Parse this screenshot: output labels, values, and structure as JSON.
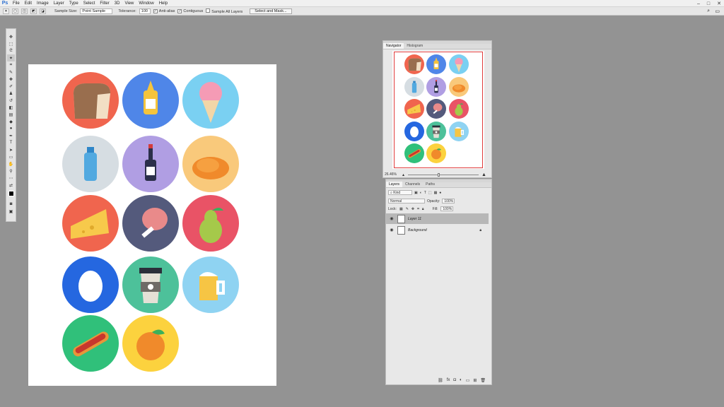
{
  "app": {
    "logo": "Ps"
  },
  "menu": [
    "File",
    "Edit",
    "Image",
    "Layer",
    "Type",
    "Select",
    "Filter",
    "3D",
    "View",
    "Window",
    "Help"
  ],
  "window_controls": [
    "–",
    "□",
    "✕"
  ],
  "options": {
    "sample_size_label": "Sample Size:",
    "sample_size_value": "Point Sample",
    "tolerance_label": "Tolerance:",
    "tolerance_value": "100",
    "anti_alias_label": "Anti-alias",
    "contiguous_label": "Contiguous",
    "sample_all_label": "Sample All Layers",
    "select_mask_label": "Select and Mask..."
  },
  "icons": [
    {
      "name": "bread-icon",
      "color": "#f0654e"
    },
    {
      "name": "mustard-icon",
      "color": "#4f86e8"
    },
    {
      "name": "icecream-icon",
      "color": "#7ad0f2"
    },
    {
      "name": "water-bottle-icon",
      "color": "#d6dde2"
    },
    {
      "name": "wine-icon",
      "color": "#b09ee3"
    },
    {
      "name": "roast-chicken-icon",
      "color": "#f9c97b"
    },
    {
      "name": "cheese-icon",
      "color": "#f0654e"
    },
    {
      "name": "ham-icon",
      "color": "#545a7c"
    },
    {
      "name": "pear-icon",
      "color": "#e95366"
    },
    {
      "name": "egg-icon",
      "color": "#2567e0"
    },
    {
      "name": "coffee-cup-icon",
      "color": "#4dc19a"
    },
    {
      "name": "beer-icon",
      "color": "#8fd3f2"
    },
    {
      "name": "hotdog-icon",
      "color": "#30c07a"
    },
    {
      "name": "orange-icon",
      "color": "#fcd23e"
    }
  ],
  "navigator": {
    "tabs": [
      "Navigator",
      "Histogram"
    ],
    "zoom": "26.46%"
  },
  "layers": {
    "tabs": [
      "Layers",
      "Channels",
      "Paths"
    ],
    "kind_label": "Kind",
    "blend_mode": "Normal",
    "opacity_label": "Opacity:",
    "opacity_value": "100%",
    "lock_label": "Lock:",
    "fill_label": "Fill:",
    "fill_value": "100%",
    "items": [
      {
        "name": "Layer 11",
        "selected": true
      },
      {
        "name": "Background",
        "selected": false
      }
    ]
  }
}
